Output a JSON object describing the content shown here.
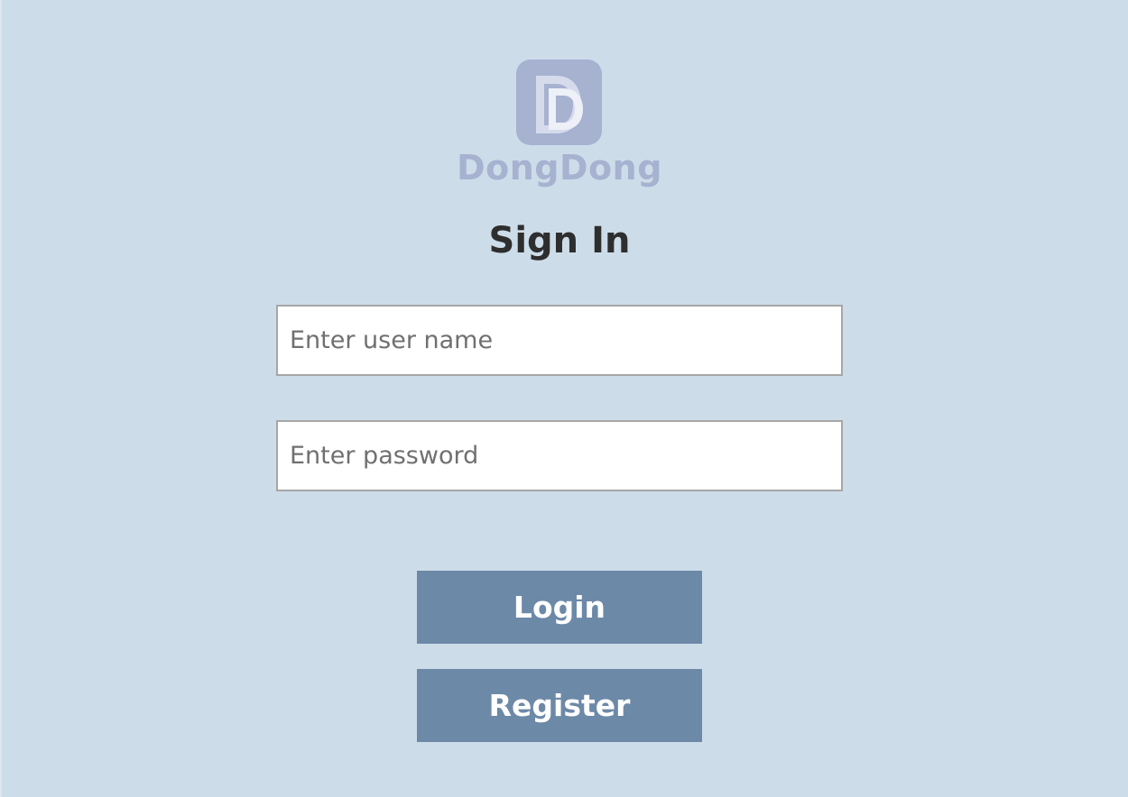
{
  "brand": {
    "logo_text": "DongDong",
    "color": "#a7b1d0"
  },
  "form": {
    "title": "Sign In",
    "username_placeholder": "Enter user name",
    "username_value": "",
    "password_placeholder": "Enter password",
    "password_value": ""
  },
  "buttons": {
    "login_label": "Login",
    "register_label": "Register"
  },
  "colors": {
    "background": "#cddce9",
    "button": "#6d89a8",
    "title": "#2e2e2e"
  }
}
